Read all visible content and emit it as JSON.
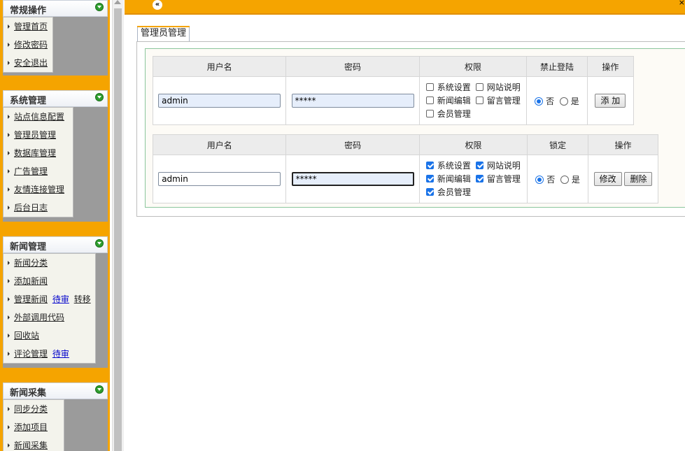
{
  "sidebar": {
    "groups": [
      {
        "title": "常规操作",
        "items": [
          {
            "label": "管理首页"
          },
          {
            "label": "修改密码"
          },
          {
            "label": "安全退出"
          }
        ]
      },
      {
        "title": "系统管理",
        "items": [
          {
            "label": "站点信息配置"
          },
          {
            "label": "管理员管理"
          },
          {
            "label": "数据库管理"
          },
          {
            "label": "广告管理"
          },
          {
            "label": "友情连接管理"
          },
          {
            "label": "后台日志"
          }
        ]
      },
      {
        "title": "新闻管理",
        "items": [
          {
            "label": "新闻分类"
          },
          {
            "label": "添加新闻"
          },
          {
            "label": "管理新闻",
            "link1": "待审",
            "link2": "转移"
          },
          {
            "label": "外部调用代码"
          },
          {
            "label": "回收站"
          },
          {
            "label": "评论管理",
            "link1": "待审"
          }
        ]
      },
      {
        "title": "新闻采集",
        "items": [
          {
            "label": "同步分类"
          },
          {
            "label": "添加项目"
          },
          {
            "label": "新闻采集"
          }
        ]
      }
    ]
  },
  "topbar": {
    "collapse_glyph": "«",
    "close_glyph": "×"
  },
  "panel": {
    "tab_label": "管理员管理"
  },
  "add_form": {
    "headers": {
      "username": "用户名",
      "password": "密码",
      "permissions": "权限",
      "ban_login": "禁止登陆",
      "action": "操作"
    },
    "username": "admin",
    "password": "*****",
    "perms": [
      {
        "label": "系统设置",
        "checked": false
      },
      {
        "label": "网站说明",
        "checked": false
      },
      {
        "label": "新闻编辑",
        "checked": false
      },
      {
        "label": "留言管理",
        "checked": false
      },
      {
        "label": "会员管理",
        "checked": false
      }
    ],
    "radio_no": "否",
    "radio_yes": "是",
    "add_button": "添 加"
  },
  "edit_form": {
    "headers": {
      "username": "用户名",
      "password": "密码",
      "permissions": "权限",
      "lock": "锁定",
      "action": "操作"
    },
    "username": "admin",
    "password": "*****",
    "perms": [
      {
        "label": "系统设置",
        "checked": true
      },
      {
        "label": "网站说明",
        "checked": true
      },
      {
        "label": "新闻编辑",
        "checked": true
      },
      {
        "label": "留言管理",
        "checked": true
      },
      {
        "label": "会员管理",
        "checked": true
      }
    ],
    "radio_no": "否",
    "radio_yes": "是",
    "modify_button": "修改",
    "delete_button": "删除"
  },
  "colors": {
    "frame_orange": "#f5a400",
    "accent_blue": "#1a73e8",
    "inner_border": "#8cc69c"
  },
  "icons": {
    "group_toggle": "expand-arrow-icon",
    "menu_bullet": "triangle-right-icon",
    "collapse": "double-left-chevron-icon"
  }
}
